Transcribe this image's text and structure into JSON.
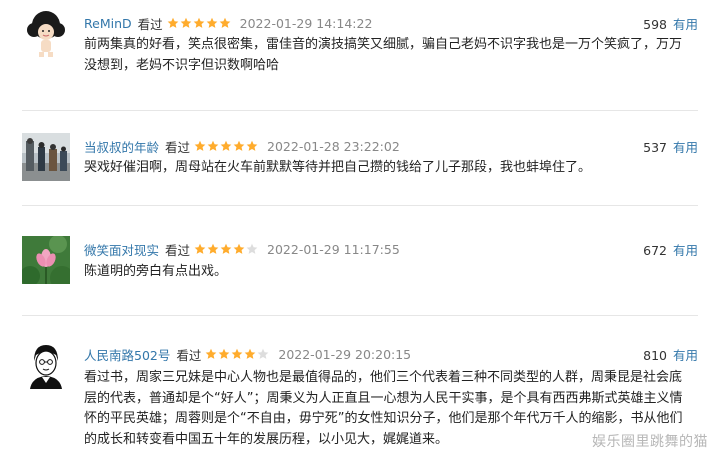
{
  "reviews": [
    {
      "user": "ReMinD",
      "status": "看过",
      "rating": 5,
      "date": "2022-01-29 14:14:22",
      "votes": "598",
      "useful_label": "有用",
      "content": "前两集真的好看，笑点很密集，雷佳音的演技搞笑又细腻，骗自己老妈不识字我也是一万个笑疯了，万万没想到，老妈不识字但识数啊哈哈",
      "avatar_icon": "afro-cartoon-avatar-icon"
    },
    {
      "user": "当叔叔的年龄",
      "status": "看过",
      "rating": 5,
      "date": "2022-01-28 23:22:02",
      "votes": "537",
      "useful_label": "有用",
      "content": "哭戏好催泪啊，周母站在火车前默默等待并把自己攒的钱给了儿子那段，我也蚌埠住了。",
      "avatar_icon": "street-photo-avatar-icon"
    },
    {
      "user": "微笑面对现实",
      "status": "看过",
      "rating": 4,
      "date": "2022-01-29 11:17:55",
      "votes": "672",
      "useful_label": "有用",
      "content": "陈道明的旁白有点出戏。",
      "avatar_icon": "lotus-flower-avatar-icon"
    },
    {
      "user": "人民南路502号",
      "status": "看过",
      "rating": 4,
      "date": "2022-01-29 20:20:15",
      "votes": "810",
      "useful_label": "有用",
      "content": "看过书，周家三兄妹是中心人物也是最值得品的，他们三个代表着三种不同类型的人群，周秉昆是社会底层的代表，普通却是个“好人”；周秉义为人正直且一心想为人民干实事，是个具有西西弗斯式英雄主义情怀的平民英雄；周蓉则是个“不自由，毋宁死”的女性知识分子，他们是那个年代万千人的缩影，书从他们的成长和转变看中国五十年的发展历程，以小见大，娓娓道来。",
      "avatar_icon": "cartoon-man-avatar-icon"
    }
  ],
  "watermark": "娱乐圈里跳舞的猫",
  "colors": {
    "link": "#3377aa",
    "star_filled": "#ffac2d",
    "star_empty": "#dddddd",
    "date": "#888888"
  }
}
